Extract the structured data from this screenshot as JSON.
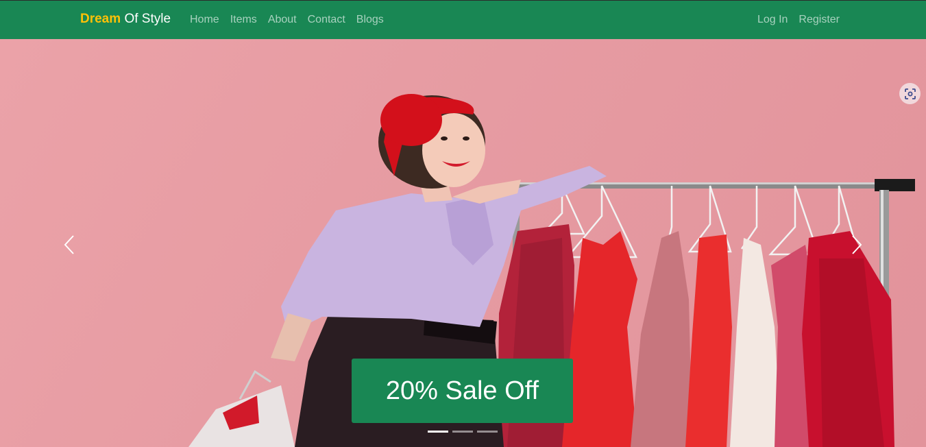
{
  "nav": {
    "brand_part1": "Dream",
    "brand_part2": "Of Style",
    "links": [
      "Home",
      "Items",
      "About",
      "Contact",
      "Blogs"
    ],
    "auth": {
      "login": "Log In",
      "register": "Register"
    }
  },
  "carousel": {
    "caption": "20% Sale Off",
    "slide_count": 3,
    "active_slide": 1,
    "prev_icon": "chevron-left-icon",
    "next_icon": "chevron-right-icon"
  },
  "colors": {
    "navbar": "#198754",
    "brand_accent": "#ffc107",
    "caption_bg": "#198754",
    "hero_bg": "#e69ba2"
  }
}
